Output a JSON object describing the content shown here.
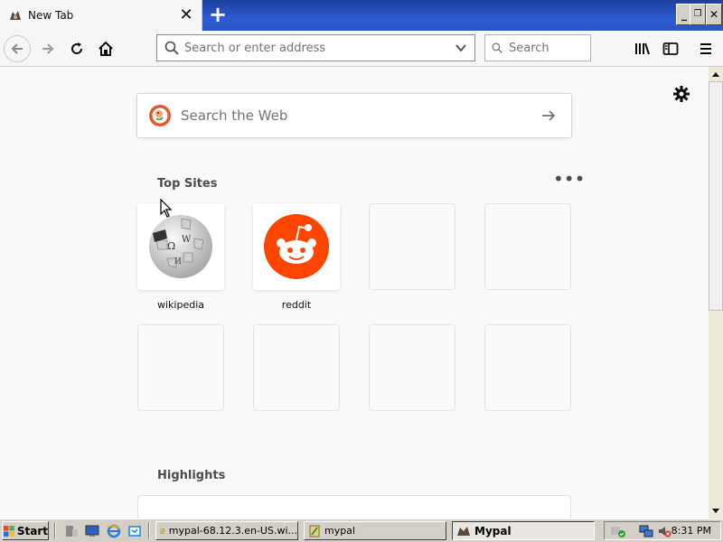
{
  "tabs": [
    {
      "title": "New Tab",
      "favicon": "mypal-icon"
    }
  ],
  "toolbar": {
    "address_placeholder": "Search or enter address",
    "search_placeholder": "Search"
  },
  "newtab": {
    "web_search_placeholder": "Search the Web",
    "top_sites_title": "Top Sites",
    "highlights_title": "Highlights",
    "top_sites": [
      {
        "label": "wikipedia",
        "icon": "wikipedia-globe-icon"
      },
      {
        "label": "reddit",
        "icon": "reddit-alien-icon"
      }
    ]
  },
  "taskbar": {
    "start_label": "Start",
    "items": [
      {
        "label": "mypal-68.12.3.en-US.wi..."
      },
      {
        "label": "mypal"
      },
      {
        "label": "Mypal"
      }
    ],
    "clock": "8:31 PM"
  },
  "colors": {
    "titlebar": "#2d5bd2",
    "reddit": "#ff4500",
    "duckduckgo": "#de5833"
  }
}
